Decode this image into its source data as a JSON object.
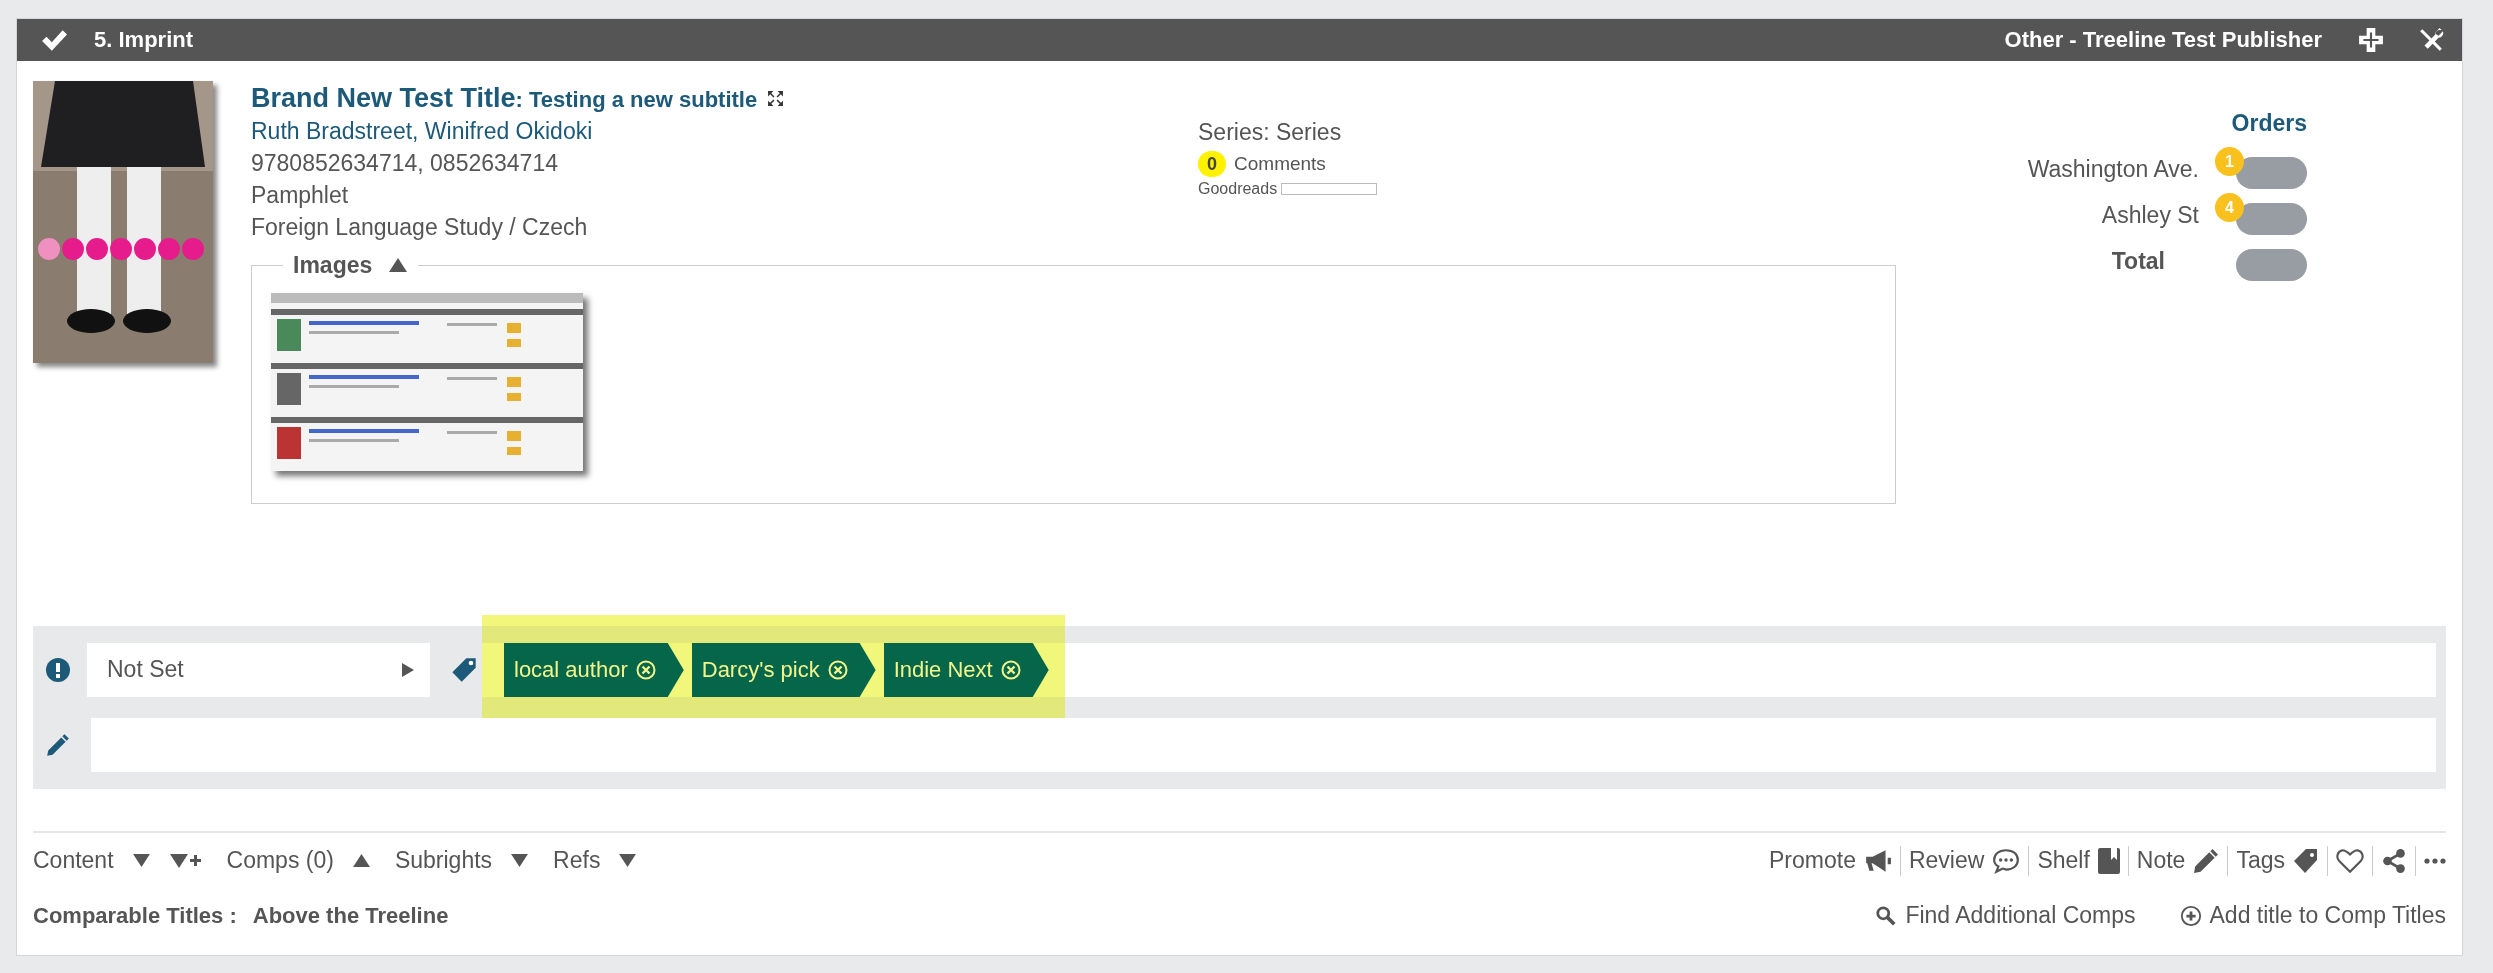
{
  "header": {
    "checked": true,
    "title": "5. Imprint",
    "publisher": "Other - Treeline Test Publisher"
  },
  "book": {
    "title": "Brand New Test Title",
    "subtitle": ": Testing a new subtitle",
    "authors": "Ruth Bradstreet, Winifred Okidoki",
    "isbn": "9780852634714, 0852634714",
    "format": "Pamphlet",
    "category": "Foreign Language Study / Czech"
  },
  "series": "Series: Series",
  "comments": {
    "count": "0",
    "label": "Comments"
  },
  "goodreads": {
    "label": "Goodreads"
  },
  "orders": {
    "title": "Orders",
    "rows": [
      {
        "kind": "store",
        "label": "Washington Ave.",
        "count": "1"
      },
      {
        "kind": "store",
        "label": "Ashley St",
        "count": "4"
      },
      {
        "kind": "total",
        "label": "Total"
      }
    ]
  },
  "images": {
    "legend": "Images",
    "expanded": true
  },
  "status": {
    "value": "Not Set"
  },
  "tags": [
    {
      "label": "local author"
    },
    {
      "label": "Darcy's pick"
    },
    {
      "label": "Indie Next"
    }
  ],
  "toolbar": {
    "sections": [
      {
        "label": "Content",
        "expanded": false,
        "addable": true
      },
      {
        "label": "Comps (0)",
        "expanded": true,
        "addable": false
      },
      {
        "label": "Subrights",
        "expanded": false,
        "addable": false
      },
      {
        "label": "Refs",
        "expanded": false,
        "addable": false
      }
    ],
    "actions": [
      {
        "kind": "megaphone",
        "label": "Promote"
      },
      {
        "kind": "speech",
        "label": "Review"
      },
      {
        "kind": "book",
        "label": "Shelf"
      },
      {
        "kind": "pencil",
        "label": "Note"
      },
      {
        "kind": "tag",
        "label": "Tags"
      },
      {
        "kind": "heart"
      },
      {
        "kind": "share"
      },
      {
        "kind": "more"
      }
    ]
  },
  "comparable": {
    "label": "Comparable Titles :",
    "value": "Above the Treeline",
    "links": [
      {
        "kind": "search",
        "label": "Find Additional Comps"
      },
      {
        "kind": "add",
        "label": "Add title to Comp Titles"
      }
    ]
  }
}
